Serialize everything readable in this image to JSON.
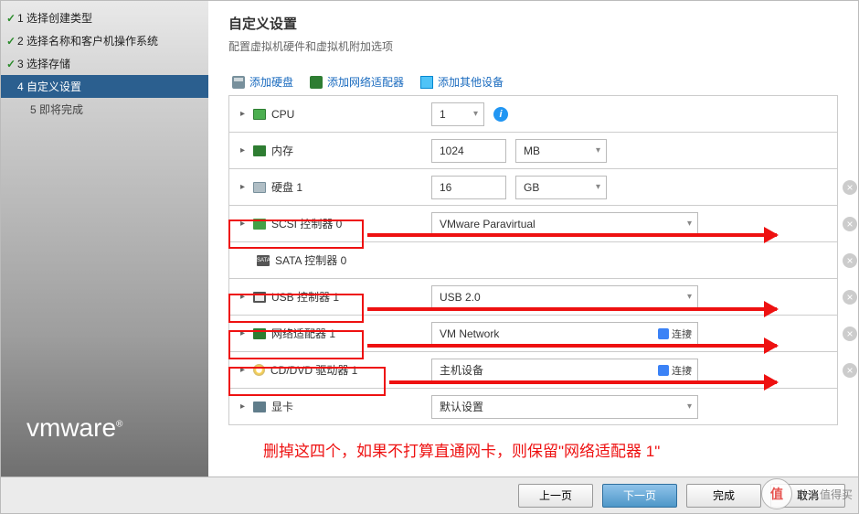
{
  "sidebar": {
    "steps": [
      {
        "label": "1 选择创建类型"
      },
      {
        "label": "2 选择名称和客户机操作系统"
      },
      {
        "label": "3 选择存储"
      },
      {
        "label": "4 自定义设置"
      },
      {
        "label": "5 即将完成"
      }
    ],
    "logo": "vmware"
  },
  "header": {
    "title": "自定义设置",
    "subtitle": "配置虚拟机硬件和虚拟机附加选项"
  },
  "toolbar": {
    "add_disk": "添加硬盘",
    "add_nic": "添加网络适配器",
    "add_other": "添加其他设备"
  },
  "hw": {
    "cpu": {
      "label": "CPU",
      "value": "1"
    },
    "mem": {
      "label": "内存",
      "value": "1024",
      "unit": "MB"
    },
    "disk": {
      "label": "硬盘 1",
      "value": "16",
      "unit": "GB"
    },
    "scsi": {
      "label": "SCSI 控制器 0",
      "value": "VMware Paravirtual"
    },
    "sata": {
      "label": "SATA 控制器 0"
    },
    "usb": {
      "label": "USB 控制器 1",
      "value": "USB 2.0"
    },
    "nic": {
      "label": "网络适配器 1",
      "value": "VM Network",
      "connect": "连接"
    },
    "cd": {
      "label": "CD/DVD 驱动器 1",
      "value": "主机设备",
      "connect": "连接"
    },
    "gpu": {
      "label": "显卡",
      "value": "默认设置"
    }
  },
  "annotation": "删掉这四个，如果不打算直通网卡，则保留\"网络适配器 1\"",
  "footer": {
    "back": "上一页",
    "next": "下一页",
    "finish": "完成",
    "cancel": "取消"
  },
  "watermark": {
    "char": "值",
    "text": "什么值得买"
  }
}
